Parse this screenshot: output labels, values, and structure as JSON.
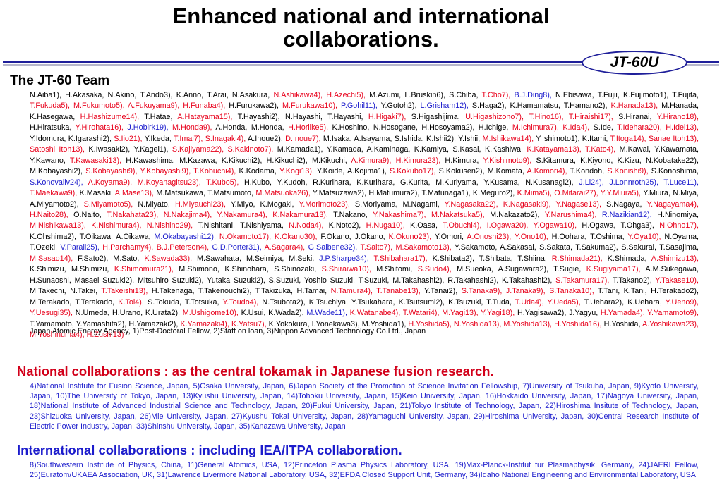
{
  "title": {
    "line1": "Enhanced national and international",
    "line2": "collaborations."
  },
  "badge": "JT-60U",
  "team_heading": "The JT-60 Team",
  "colors": {
    "affiliation_red": "#e8001b",
    "affiliation_blue": "#1c1ccc",
    "rule_blue": "#1f1f9a"
  },
  "team_names": [
    {
      "t": "N.Aiba1), H.Akasaka, N.Akino, T.Ando3), K.Anno, T.Arai, N.Asakura, ",
      "c": ""
    },
    {
      "t": "N.Ashikawa4), H.Azechi5),",
      "c": "r"
    },
    {
      "t": " M.Azumi, L.Bruskin6), S.Chiba, ",
      "c": ""
    },
    {
      "t": "T.Cho7),",
      "c": "r"
    },
    {
      "t": " ",
      "c": ""
    },
    {
      "t": "B.J.Ding8),",
      "c": "b"
    },
    {
      "t": " N.Ebisawa, T.Fujii, K.Fujimoto1), T.Fujita, ",
      "c": ""
    },
    {
      "t": "T.Fukuda5), M.Fukumoto5), A.Fukuyama9), H.Funaba4),",
      "c": "r"
    },
    {
      "t": " H.Furukawa2), ",
      "c": ""
    },
    {
      "t": "M.Furukawa10),",
      "c": "r"
    },
    {
      "t": " ",
      "c": ""
    },
    {
      "t": "P.Gohil11),",
      "c": "b"
    },
    {
      "t": " Y.Gotoh2), ",
      "c": ""
    },
    {
      "t": "L.Grisham12),",
      "c": "b"
    },
    {
      "t": " S.Haga2), K.Hamamatsu, T.Hamano2), ",
      "c": ""
    },
    {
      "t": "K.Hanada13),",
      "c": "r"
    },
    {
      "t": " M.Hanada, K.Hasegawa, ",
      "c": ""
    },
    {
      "t": "H.Hashizume14),",
      "c": "r"
    },
    {
      "t": " T.Hatae, ",
      "c": ""
    },
    {
      "t": "A.Hatayama15),",
      "c": "r"
    },
    {
      "t": " T.Hayashi2), N.Hayashi, T.Hayashi, ",
      "c": ""
    },
    {
      "t": "H.Higaki7),",
      "c": "r"
    },
    {
      "t": " S.Higashijima, ",
      "c": ""
    },
    {
      "t": "U.Higashizono7), T.Hino16), T.Hiraishi17),",
      "c": "r"
    },
    {
      "t": " S.Hiranai, ",
      "c": ""
    },
    {
      "t": "Y.Hirano18),",
      "c": "r"
    },
    {
      "t": " H.Hiratsuka, ",
      "c": ""
    },
    {
      "t": "Y.Hirohata16),",
      "c": "r"
    },
    {
      "t": " ",
      "c": ""
    },
    {
      "t": "J.Hobirk19),",
      "c": "b"
    },
    {
      "t": " ",
      "c": ""
    },
    {
      "t": "M.Honda9),",
      "c": "r"
    },
    {
      "t": " A.Honda, M.Honda, ",
      "c": ""
    },
    {
      "t": "H.Horiike5),",
      "c": "r"
    },
    {
      "t": " K.Hoshino, N.Hosogane, H.Hosoyama2), H.Ichige, ",
      "c": ""
    },
    {
      "t": "M.Ichimura7), K.Ida4),",
      "c": "r"
    },
    {
      "t": " S.Ide, ",
      "c": ""
    },
    {
      "t": "T.Idehara20), H.Idei13),",
      "c": "r"
    },
    {
      "t": " Y.Idomura, K.Igarashi2), ",
      "c": ""
    },
    {
      "t": "S.Iio21),",
      "c": "r"
    },
    {
      "t": " Y.Ikeda, ",
      "c": ""
    },
    {
      "t": "T.Imai7), S.Inagaki4),",
      "c": "r"
    },
    {
      "t": " A.Inoue2), ",
      "c": ""
    },
    {
      "t": "D.Inoue7),",
      "c": "r"
    },
    {
      "t": " M.Isaka, A.Isayama, S.Ishida, K.Ishii2), Y.Ishii, ",
      "c": ""
    },
    {
      "t": "M.Ishikawa14),",
      "c": "r"
    },
    {
      "t": " Y.Ishimoto1), K.Itami, ",
      "c": ""
    },
    {
      "t": "T.Itoga14), Sanae Itoh13), Satoshi Itoh13),",
      "c": "r"
    },
    {
      "t": " K.Iwasaki2), Y.Kagei1), ",
      "c": ""
    },
    {
      "t": "S.Kajiyama22), S.Kakinoto7),",
      "c": "r"
    },
    {
      "t": " M.Kamada1), Y.Kamada, A.Kaminaga, K.Kamiya, S.Kasai, K.Kashiwa, ",
      "c": ""
    },
    {
      "t": "K.Katayama13), T.Kato4),",
      "c": "r"
    },
    {
      "t": " M.Kawai, Y.Kawamata, Y.Kawano, ",
      "c": ""
    },
    {
      "t": "T.Kawasaki13),",
      "c": "r"
    },
    {
      "t": " H.Kawashima, M.Kazawa, K.Kikuchi2), H.Kikuchi2), M.Kikuchi, ",
      "c": ""
    },
    {
      "t": "A.Kimura9), H.Kimura23),",
      "c": "r"
    },
    {
      "t": " H.Kimura, ",
      "c": ""
    },
    {
      "t": "Y.Kishimoto9),",
      "c": "r"
    },
    {
      "t": " S.Kitamura, K.Kiyono, K.Kizu, N.Kobatake22), M.Kobayashi2), ",
      "c": ""
    },
    {
      "t": "S.Kobayashi9), Y.Kobayashi9), T.Kobuchi4),",
      "c": "r"
    },
    {
      "t": " K.Kodama, ",
      "c": ""
    },
    {
      "t": "Y.Kogi13),",
      "c": "r"
    },
    {
      "t": " Y.Koide, A.Kojima1), ",
      "c": ""
    },
    {
      "t": "S.Kokubo17),",
      "c": "r"
    },
    {
      "t": " S.Kokusen2), M.Komata, ",
      "c": ""
    },
    {
      "t": "A.Komori4),",
      "c": "r"
    },
    {
      "t": " T.Kondoh, ",
      "c": ""
    },
    {
      "t": "S.Konishi9),",
      "c": "r"
    },
    {
      "t": " S.Konoshima, ",
      "c": ""
    },
    {
      "t": "S.Konovaliv24),",
      "c": "b"
    },
    {
      "t": " ",
      "c": ""
    },
    {
      "t": "A.Koyama9), M.Koyanagitsu23), T.Kubo5),",
      "c": "r"
    },
    {
      "t": " H.Kubo, Y.Kudoh, R.Kurihara, K.Kurihara, G.Kurita, M.Kuriyama, Y.Kusama, N.Kusanagi2), ",
      "c": ""
    },
    {
      "t": "J.Li24), J.Lonnroth25), T.Luce11),",
      "c": "b"
    },
    {
      "t": " ",
      "c": ""
    },
    {
      "t": "T.Maekawa9),",
      "c": "r"
    },
    {
      "t": " K.Masaki, ",
      "c": ""
    },
    {
      "t": "A.Mase13),",
      "c": "r"
    },
    {
      "t": " M.Matsukawa, T.Matsumoto, ",
      "c": ""
    },
    {
      "t": "M.Matsuoka26),",
      "c": "r"
    },
    {
      "t": " Y.Matsuzawa2), H.Matumura2), T.Matunaga1), K.Meguro2), ",
      "c": ""
    },
    {
      "t": "K.Mima5), O.Mitarai27), Y.Y.Miura5),",
      "c": "r"
    },
    {
      "t": " Y.Miura, N.Miya, A.Miyamoto2), ",
      "c": ""
    },
    {
      "t": "S.Miyamoto5),",
      "c": "r"
    },
    {
      "t": " N.Miyato, ",
      "c": ""
    },
    {
      "t": "H.Miyauchi23),",
      "c": "r"
    },
    {
      "t": " Y.Miyo, K.Mogaki, ",
      "c": ""
    },
    {
      "t": "Y.Morimoto23),",
      "c": "r"
    },
    {
      "t": " S.Moriyama, M.Nagami, ",
      "c": ""
    },
    {
      "t": "Y.Nagasaka22), K.Nagasaki9), Y.Nagase13),",
      "c": "r"
    },
    {
      "t": " S.Nagaya, ",
      "c": ""
    },
    {
      "t": "Y.Nagayama4), H.Naito28),",
      "c": "r"
    },
    {
      "t": " O.Naito, ",
      "c": ""
    },
    {
      "t": "T.Nakahata23), N.Nakajima4), Y.Nakamura4), K.Nakamura13),",
      "c": "r"
    },
    {
      "t": " T.Nakano, ",
      "c": ""
    },
    {
      "t": "Y.Nakashima7), M.Nakatsuka5),",
      "c": "r"
    },
    {
      "t": " M.Nakazato2), ",
      "c": ""
    },
    {
      "t": "Y.Narushima4),",
      "c": "r"
    },
    {
      "t": " ",
      "c": ""
    },
    {
      "t": "R.Nazikian12),",
      "c": "b"
    },
    {
      "t": " H.Ninomiya, ",
      "c": ""
    },
    {
      "t": "M.Nishikawa13), K.Nishimura4), N.Nishino29),",
      "c": "r"
    },
    {
      "t": " T.Nishitani, T.Nishiyama, ",
      "c": ""
    },
    {
      "t": "N.Noda4),",
      "c": "r"
    },
    {
      "t": " K.Noto2), ",
      "c": ""
    },
    {
      "t": "H.Nuga10),",
      "c": "r"
    },
    {
      "t": " K.Oasa, ",
      "c": ""
    },
    {
      "t": "T.Obuchi4), I.Ogawa20), Y.Ogawa10),",
      "c": "r"
    },
    {
      "t": " H.Ogawa, T.Ohga3), ",
      "c": ""
    },
    {
      "t": "N.Ohno17),",
      "c": "r"
    },
    {
      "t": " K.Ohshima2), T.Oikawa, A.Oikawa, ",
      "c": ""
    },
    {
      "t": "M.Okabayashi12),",
      "c": "b"
    },
    {
      "t": " ",
      "c": ""
    },
    {
      "t": "N.Okamoto17), K.Okano30),",
      "c": "r"
    },
    {
      "t": " F.Okano, J.Okano, ",
      "c": ""
    },
    {
      "t": "K.Okuno23),",
      "c": "r"
    },
    {
      "t": " Y.Omori, ",
      "c": ""
    },
    {
      "t": "A.Onoshi23), Y.Ono10),",
      "c": "r"
    },
    {
      "t": " H.Oohara, T.Oshima, ",
      "c": ""
    },
    {
      "t": "Y.Oya10),",
      "c": "r"
    },
    {
      "t": " N.Oyama, T.Ozeki, ",
      "c": ""
    },
    {
      "t": "V.Parail25),",
      "c": "b"
    },
    {
      "t": " ",
      "c": ""
    },
    {
      "t": "H.Parchamy4),",
      "c": "r"
    },
    {
      "t": " ",
      "c": ""
    },
    {
      "t": "B.J.Peterson4),",
      "c": "r"
    },
    {
      "t": " ",
      "c": ""
    },
    {
      "t": "G.D.Porter31),",
      "c": "b"
    },
    {
      "t": " ",
      "c": ""
    },
    {
      "t": "A.Sagara4),",
      "c": "r"
    },
    {
      "t": " ",
      "c": ""
    },
    {
      "t": "G.Saibene32),",
      "c": "b"
    },
    {
      "t": " ",
      "c": ""
    },
    {
      "t": "T.Saito7), M.Sakamoto13),",
      "c": "r"
    },
    {
      "t": " Y.Sakamoto, A.Sakasai, S.Sakata, T.Sakuma2), S.Sakurai, T.Sasajima, ",
      "c": ""
    },
    {
      "t": "M.Sasao14),",
      "c": "r"
    },
    {
      "t": " F.Sato2), M.Sato, ",
      "c": ""
    },
    {
      "t": "K.Sawada33),",
      "c": "r"
    },
    {
      "t": " M.Sawahata, M.Seimiya, M.Seki, ",
      "c": ""
    },
    {
      "t": "J.P.Sharpe34),",
      "c": "b"
    },
    {
      "t": " ",
      "c": ""
    },
    {
      "t": "T.Shibahara17),",
      "c": "r"
    },
    {
      "t": " K.Shibata2), T.Shibata, T.Shiina, ",
      "c": ""
    },
    {
      "t": "R.Shimada21),",
      "c": "r"
    },
    {
      "t": " K.Shimada, ",
      "c": ""
    },
    {
      "t": "A.Shimizu13),",
      "c": "r"
    },
    {
      "t": " K.Shimizu, M.Shimizu, ",
      "c": ""
    },
    {
      "t": "K.Shimomura21),",
      "c": "r"
    },
    {
      "t": " M.Shimono, K.Shinohara, S.Shinozaki, ",
      "c": ""
    },
    {
      "t": "S.Shiraiwa10),",
      "c": "r"
    },
    {
      "t": " M.Shitomi, ",
      "c": ""
    },
    {
      "t": "S.Sudo4),",
      "c": "r"
    },
    {
      "t": " M.Sueoka, A.Sugawara2), T.Sugie, ",
      "c": ""
    },
    {
      "t": "K.Sugiyama17),",
      "c": "r"
    },
    {
      "t": " A.M.Sukegawa, H.Sunaoshi, Masaei Suzuki2), Mitsuhiro Suzuki2), Yutaka Suzuki2), S.Suzuki, Yoshio Suzuki, T.Suzuki, M.Takahashi2), R.Takahashi2), K.Takahashi2), ",
      "c": ""
    },
    {
      "t": "S.Takamura17),",
      "c": "r"
    },
    {
      "t": " T.Takano2), ",
      "c": ""
    },
    {
      "t": "Y.Takase10),",
      "c": "r"
    },
    {
      "t": " M.Takechi, N.Takei, ",
      "c": ""
    },
    {
      "t": "T.Takeishi13),",
      "c": "r"
    },
    {
      "t": " H.Takenaga, T.Takenouchi2), T.Takizuka, H.Tamai, ",
      "c": ""
    },
    {
      "t": "N.Tamura4), T.Tanabe13),",
      "c": "r"
    },
    {
      "t": " Y.Tanai2), ",
      "c": ""
    },
    {
      "t": "S.Tanaka9), J.Tanaka9), S.Tanaka10),",
      "c": "r"
    },
    {
      "t": " T.Tani, K.Tani, H.Terakado2), M.Terakado, T.Terakado, ",
      "c": ""
    },
    {
      "t": "K.Toi4),",
      "c": "r"
    },
    {
      "t": " S.Tokuda, T.Totsuka, ",
      "c": ""
    },
    {
      "t": "Y.Toudo4),",
      "c": "r"
    },
    {
      "t": " N.Tsubota2), K.Tsuchiya, Y.Tsukahara, K.Tsutsumi2), K.Tsuzuki, T.Tuda, ",
      "c": ""
    },
    {
      "t": "T.Uda4), Y.Ueda5),",
      "c": "r"
    },
    {
      "t": " T.Uehara2), K.Uehara, ",
      "c": ""
    },
    {
      "t": "Y.Ueno9), Y.Uesugi35),",
      "c": "r"
    },
    {
      "t": " N.Umeda, H.Urano, K.Urata2), ",
      "c": ""
    },
    {
      "t": "M.Ushigome10),",
      "c": "r"
    },
    {
      "t": " K.Usui, K.Wada2), ",
      "c": ""
    },
    {
      "t": "M.Wade11),",
      "c": "b"
    },
    {
      "t": " ",
      "c": ""
    },
    {
      "t": "K.Watanabe4), T.Watari4), M.Yagi13), Y.Yagi18),",
      "c": "r"
    },
    {
      "t": " H.Yagisawa2), J.Yagyu, ",
      "c": ""
    },
    {
      "t": "H.Yamada4), Y.Yamamoto9),",
      "c": "r"
    },
    {
      "t": " T.Yamamoto, Y.Yamashita2), H.Yamazaki2), ",
      "c": ""
    },
    {
      "t": "K.Yamazaki4), K.Yatsu7),",
      "c": "r"
    },
    {
      "t": " K.Yokokura, I.Yonekawa3), M.Yoshida1), ",
      "c": ""
    },
    {
      "t": "H.Yoshida5), N.Yoshida13), M.Yoshida13), H.Yoshida16),",
      "c": "r"
    },
    {
      "t": " H.Yoshida, ",
      "c": ""
    },
    {
      "t": "A.Yoshikawa23), M.Yoshinuma4), H.Zushi13)",
      "c": "r"
    }
  ],
  "affiliation_line": "Japan Atomic Energy Agency, 1)Post-Doctoral Fellow, 2)Staff on loan, 3)Nippon Advanced Technology Co.Ltd., Japan",
  "national": {
    "heading": "National collaborations : as the central tokamak in Japanese fusion research.",
    "text": "4)National Institute for Fusion Science, Japan, 5)Osaka University, Japan, 6)Japan Society of the Promotion of Science Invitation Fellowship, 7)University of Tsukuba, Japan, 9)Kyoto University, Japan, 10)The University of Tokyo, Japan, 13)Kyushu University, Japan, 14)Tohoku University, Japan, 15)Keio University, Japan, 16)Hokkaido University, Japan, 17)Nagoya University, Japan, 18)National Institute of Advanced Industrial Science and Technology, Japan, 20)Fukui University, Japan, 21)Tokyo Institute of Technology, Japan, 22)Hiroshima Insitute of Technology, Japan, 23)Shizuoka University, Japan, 26)Mie University, Japan, 27)Kyushu Tokai University, Japan, 28)Yamaguchi University, Japan, 29)Hiroshima University, Japan, 30)Central Research Institute of Electric Power Industry, Japan, 33)Shinshu University, Japan, 35)Kanazawa University, Japan"
  },
  "international": {
    "heading": "International collaborations : including IEA/ITPA collaboration.",
    "text": "8)Southwestern Institute of Physics, China, 11)General Atomics, USA, 12)Princeton Plasma Physics Laboratory, USA, 19)Max-Planck-Institut fur Plasmaphysik, Germany, 24)JAERI Fellow, 25)Euratom/UKAEA Association, UK, 31)Lawrence Livermore National Laboratory, USA, 32)EFDA Closed Support Unit, Germany, 34)Idaho National Engineering and Environmental Laboratory, USA"
  }
}
